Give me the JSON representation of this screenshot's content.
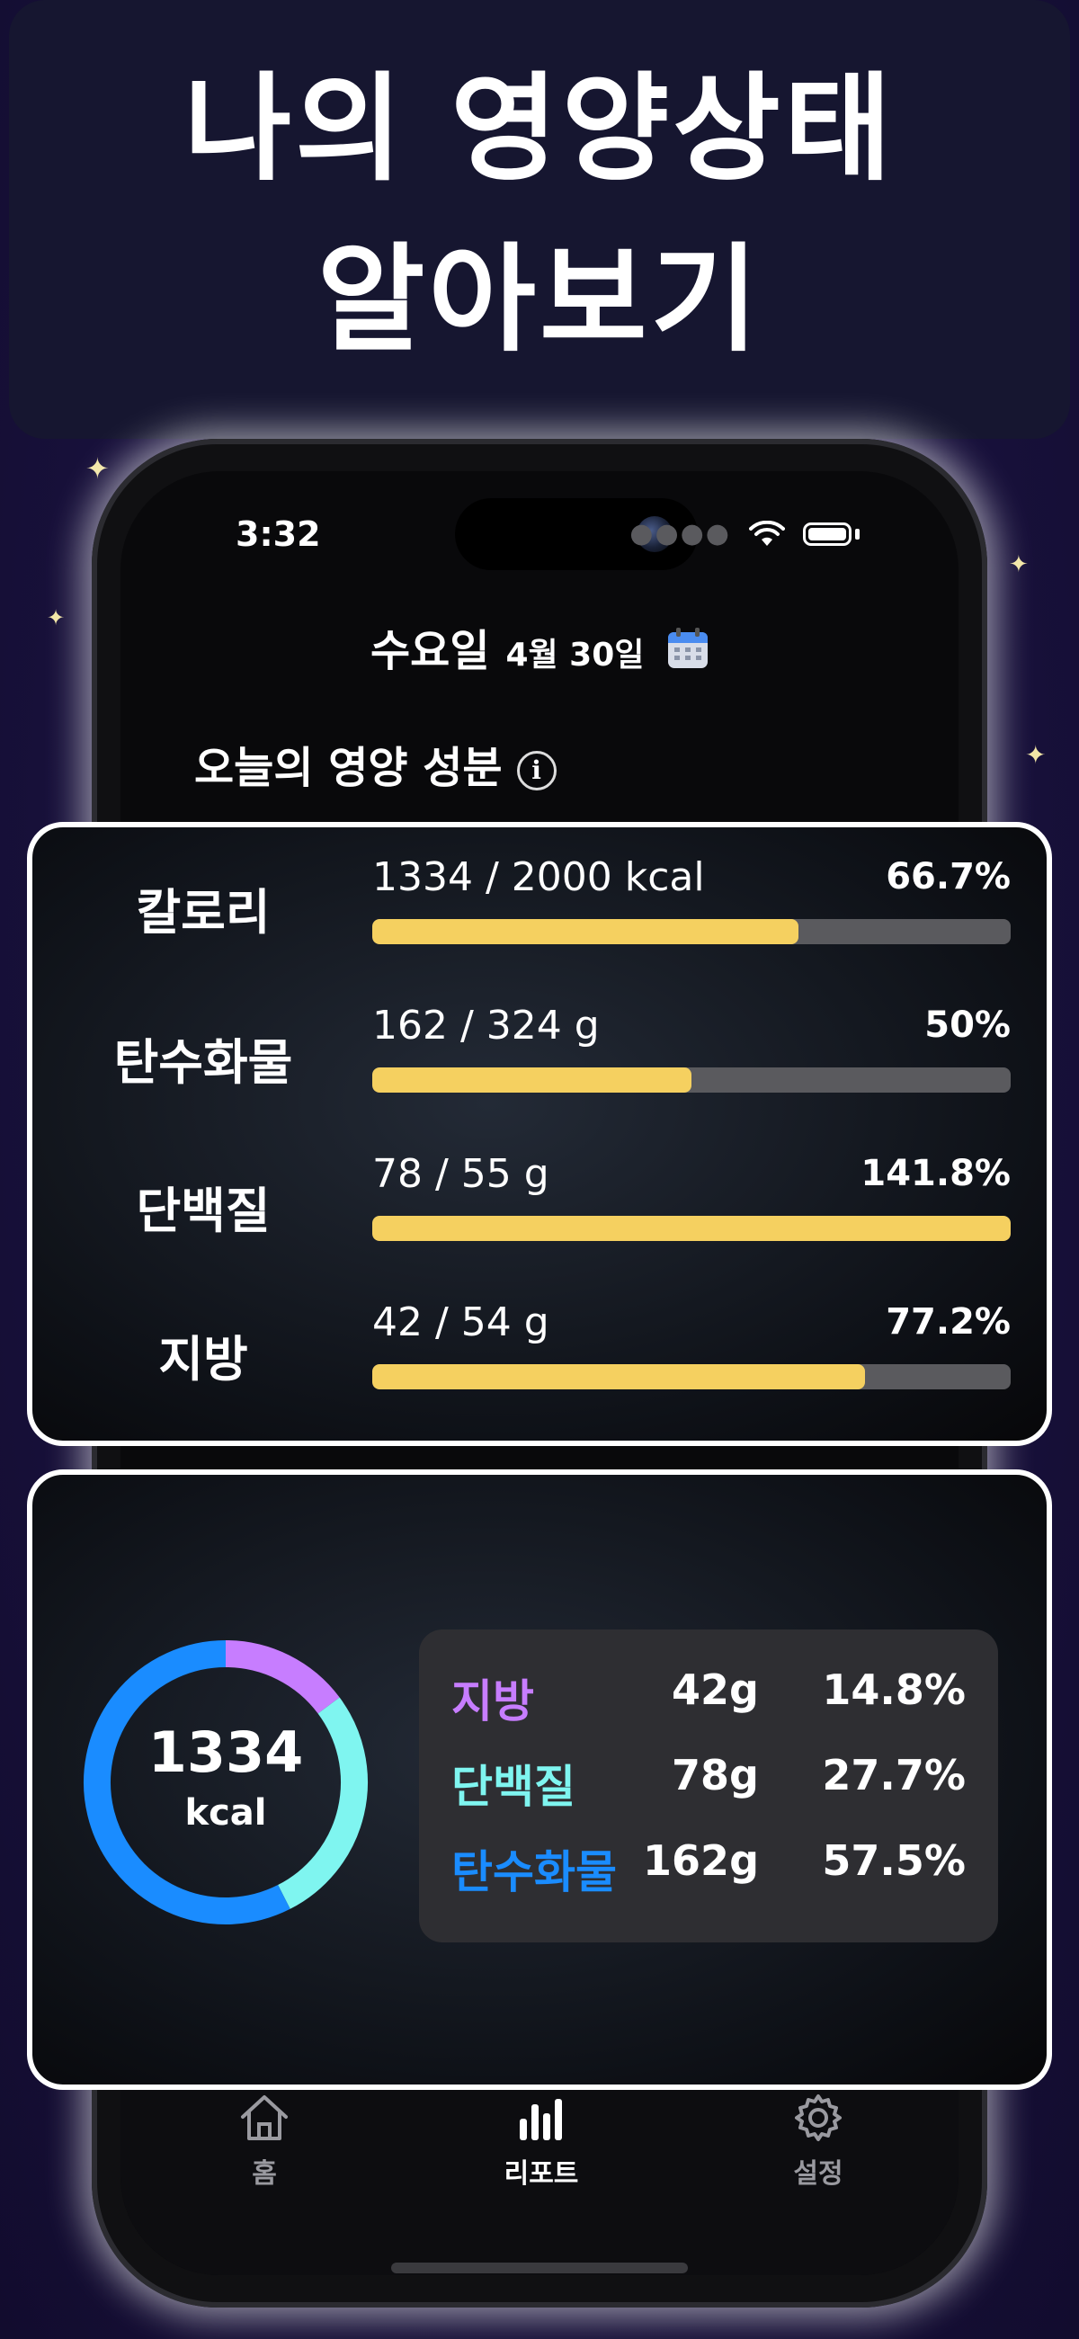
{
  "headline": {
    "line1": "나의 영양상태",
    "line2": "알아보기"
  },
  "status_bar": {
    "time": "3:32"
  },
  "date_header": {
    "weekday": "수요일",
    "date": "4월 30일"
  },
  "section_title": "오늘의 영양 성분",
  "nutrients": [
    {
      "name": "칼로리",
      "amount": "1334 / 2000 kcal",
      "percent": "66.7%",
      "progress": 0.667
    },
    {
      "name": "탄수화물",
      "amount": "162 / 324 g",
      "percent": "50%",
      "progress": 0.5
    },
    {
      "name": "단백질",
      "amount": "78 / 55 g",
      "percent": "141.8%",
      "progress": 1.0
    },
    {
      "name": "지방",
      "amount": "42 / 54 g",
      "percent": "77.2%",
      "progress": 0.772
    }
  ],
  "donut": {
    "total": "1334",
    "unit": "kcal",
    "segments": [
      {
        "name": "지방",
        "grams": "42g",
        "percent": "14.8%",
        "value": 14.8,
        "color": "#c77dff"
      },
      {
        "name": "단백질",
        "grams": "78g",
        "percent": "27.7%",
        "value": 27.7,
        "color": "#7ff5f0"
      },
      {
        "name": "탄수화물",
        "grams": "162g",
        "percent": "57.5%",
        "value": 57.5,
        "color": "#1a8cff"
      }
    ]
  },
  "tabs": [
    {
      "label": "홈",
      "icon": "home-icon"
    },
    {
      "label": "리포트",
      "icon": "bar-chart-icon",
      "active": true
    },
    {
      "label": "설정",
      "icon": "gear-icon"
    }
  ],
  "colors": {
    "bar_fill": "#f5d060",
    "bar_track": "#5a5a5e",
    "accent_green": "#2fd58a"
  }
}
